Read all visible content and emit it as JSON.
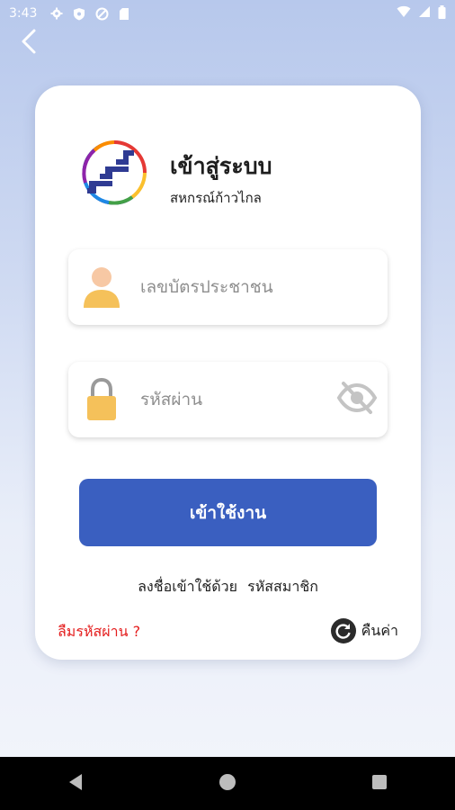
{
  "status_bar": {
    "time": "3:43",
    "left_icons": [
      "gear-icon",
      "shield-icon",
      "no-disturb-icon",
      "sd-card-icon"
    ],
    "right_icons": [
      "wifi-icon",
      "signal-icon",
      "battery-icon"
    ]
  },
  "header": {
    "back_icon": "chevron-left-icon"
  },
  "login_card": {
    "title": "เข้าสู่ระบบ",
    "subtitle": "สหกรณ์ก้าวไกล",
    "id_field": {
      "placeholder": "เลขบัตรประชาชน",
      "value": "",
      "icon": "user-icon"
    },
    "password_field": {
      "placeholder": "รหัสผ่าน",
      "value": "",
      "icon": "lock-icon",
      "toggle_icon": "eye-off-icon"
    },
    "login_button": "เข้าใช้งาน",
    "alt_login_prefix": "ลงชื่อเข้าใช้ด้วย",
    "alt_login_link": "รหัสสมาชิก",
    "forgot_password": "ลืมรหัสผ่าน ?",
    "restore_label": "คืนค่า",
    "restore_icon": "restore-icon"
  },
  "colors": {
    "primary_button": "#3a5fc0",
    "forgot_link": "#e41d1d",
    "user_icon": "#f5c15a",
    "lock_icon": "#f5c15a"
  },
  "nav_bar": {
    "icons": [
      "back-triangle-icon",
      "home-circle-icon",
      "recents-square-icon"
    ]
  }
}
